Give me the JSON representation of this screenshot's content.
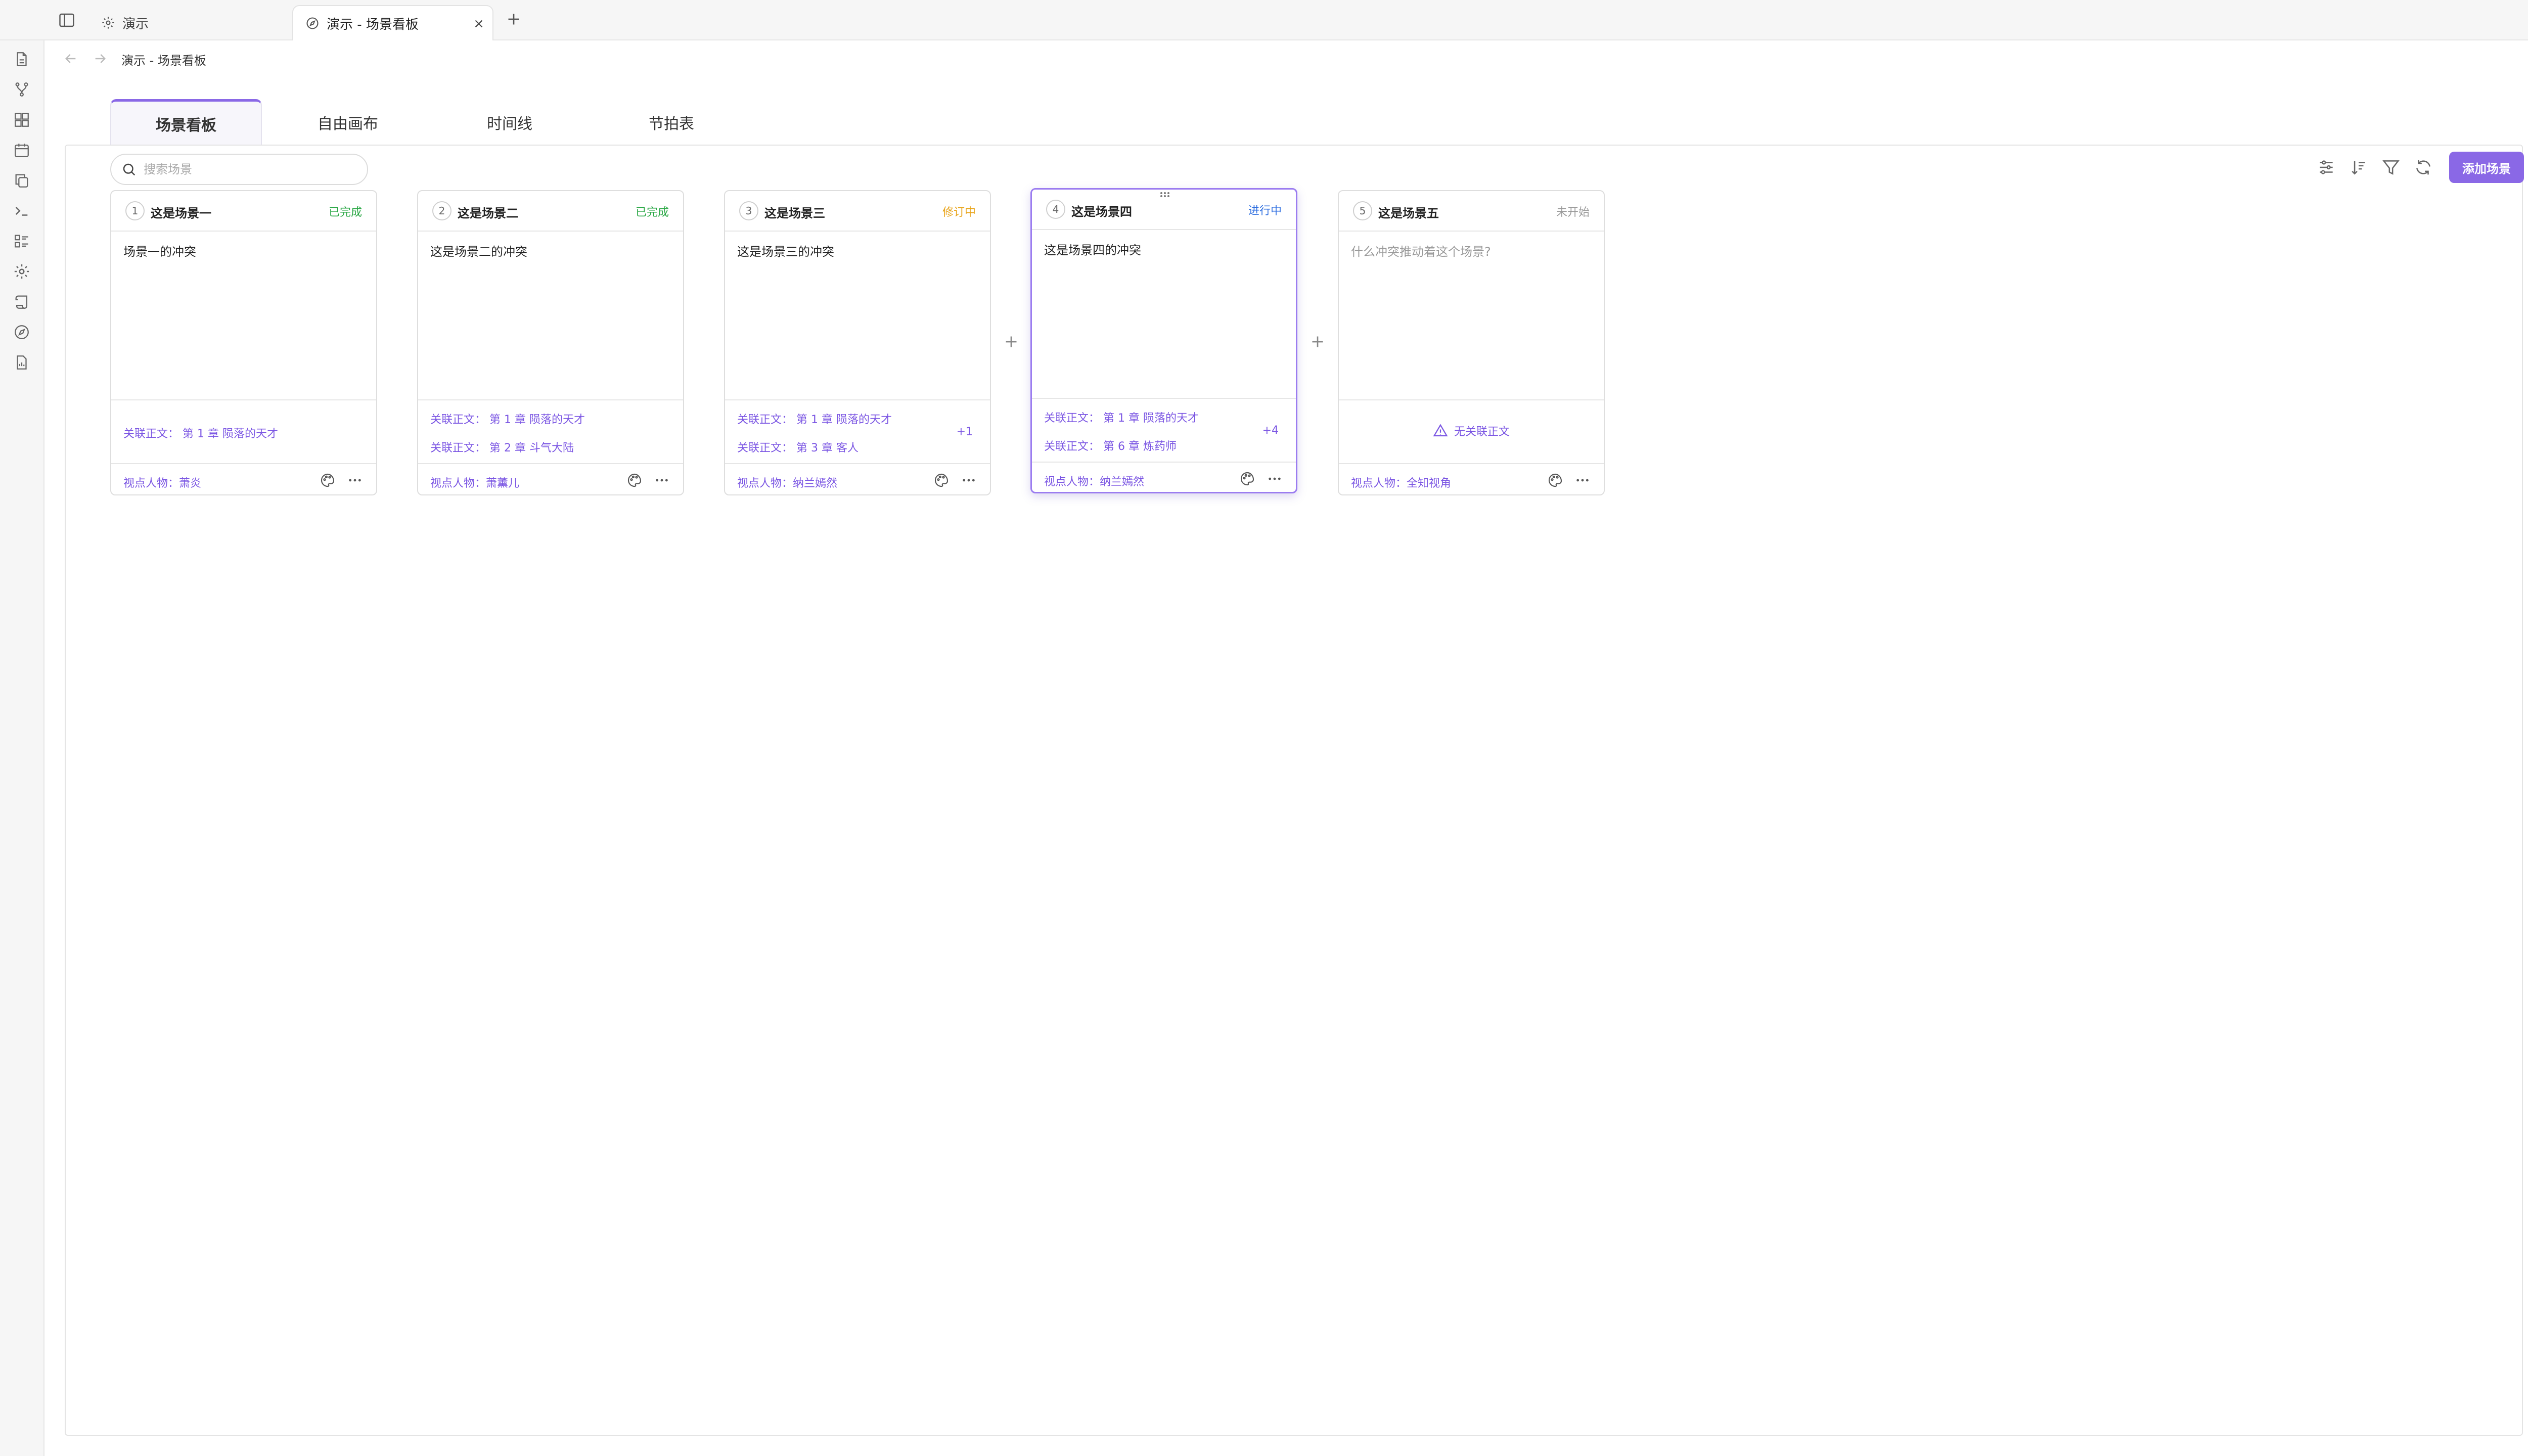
{
  "tabs": [
    {
      "label": "演示",
      "icon": "gear-icon",
      "active": false
    },
    {
      "label": "演示 - 场景看板",
      "icon": "compass-icon",
      "active": true
    }
  ],
  "breadcrumb": "演示 - 场景看板",
  "view_tabs": [
    "场景看板",
    "自由画布",
    "时间线",
    "节拍表"
  ],
  "toolbar": {
    "search_placeholder": "搜索场景",
    "add_scene_label": "添加场景"
  },
  "cards": [
    {
      "num": "1",
      "title": "这是场景一",
      "status": "已完成",
      "status_color": "#29a744",
      "body": "场景一的冲突",
      "links": [
        "关联正文：  第 1 章 陨落的天才"
      ],
      "more": "",
      "pov": "视点人物：萧炎"
    },
    {
      "num": "2",
      "title": "这是场景二",
      "status": "已完成",
      "status_color": "#29a744",
      "body": "这是场景二的冲突",
      "links": [
        "关联正文：  第 1 章 陨落的天才",
        "关联正文：  第 2 章 斗气大陆"
      ],
      "more": "",
      "pov": "视点人物：萧薰儿"
    },
    {
      "num": "3",
      "title": "这是场景三",
      "status": "修订中",
      "status_color": "#e8a317",
      "body": "这是场景三的冲突",
      "links": [
        "关联正文：  第 1 章 陨落的天才",
        "关联正文：  第 3 章 客人"
      ],
      "more": "+1",
      "pov": "视点人物：纳兰嫣然"
    },
    {
      "num": "4",
      "title": "这是场景四",
      "status": "进行中",
      "status_color": "#2f6fe0",
      "body": "这是场景四的冲突",
      "links": [
        "关联正文：  第 1 章 陨落的天才",
        "关联正文：  第 6 章 炼药师"
      ],
      "more": "+4",
      "pov": "视点人物：纳兰嫣然"
    },
    {
      "num": "5",
      "title": "这是场景五",
      "status": "未开始",
      "status_color": "#999999",
      "body": "什么冲突推动着这个场景?",
      "links": [],
      "no_link": "无关联正文",
      "more": "",
      "pov": "视点人物：全知视角"
    }
  ],
  "colors": {
    "accent": "#8a68e6",
    "link": "#7b56e3",
    "done": "#29a744",
    "revising": "#e8a317",
    "in_progress": "#2f6fe0",
    "not_started": "#999999"
  }
}
